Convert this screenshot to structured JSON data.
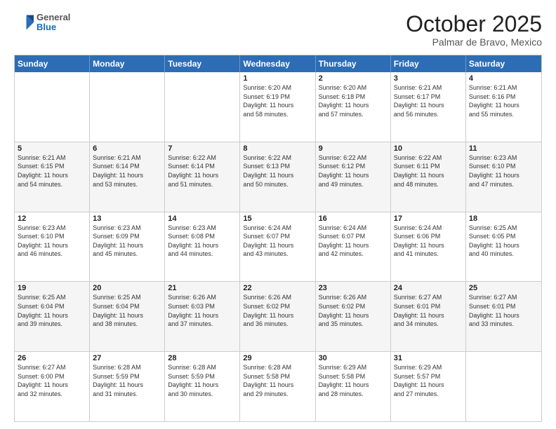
{
  "header": {
    "logo": {
      "general": "General",
      "blue": "Blue"
    },
    "title": "October 2025",
    "location": "Palmar de Bravo, Mexico"
  },
  "calendar": {
    "days": [
      "Sunday",
      "Monday",
      "Tuesday",
      "Wednesday",
      "Thursday",
      "Friday",
      "Saturday"
    ],
    "rows": [
      [
        {
          "day": "",
          "info": ""
        },
        {
          "day": "",
          "info": ""
        },
        {
          "day": "",
          "info": ""
        },
        {
          "day": "1",
          "info": "Sunrise: 6:20 AM\nSunset: 6:19 PM\nDaylight: 11 hours\nand 58 minutes."
        },
        {
          "day": "2",
          "info": "Sunrise: 6:20 AM\nSunset: 6:18 PM\nDaylight: 11 hours\nand 57 minutes."
        },
        {
          "day": "3",
          "info": "Sunrise: 6:21 AM\nSunset: 6:17 PM\nDaylight: 11 hours\nand 56 minutes."
        },
        {
          "day": "4",
          "info": "Sunrise: 6:21 AM\nSunset: 6:16 PM\nDaylight: 11 hours\nand 55 minutes."
        }
      ],
      [
        {
          "day": "5",
          "info": "Sunrise: 6:21 AM\nSunset: 6:15 PM\nDaylight: 11 hours\nand 54 minutes."
        },
        {
          "day": "6",
          "info": "Sunrise: 6:21 AM\nSunset: 6:14 PM\nDaylight: 11 hours\nand 53 minutes."
        },
        {
          "day": "7",
          "info": "Sunrise: 6:22 AM\nSunset: 6:14 PM\nDaylight: 11 hours\nand 51 minutes."
        },
        {
          "day": "8",
          "info": "Sunrise: 6:22 AM\nSunset: 6:13 PM\nDaylight: 11 hours\nand 50 minutes."
        },
        {
          "day": "9",
          "info": "Sunrise: 6:22 AM\nSunset: 6:12 PM\nDaylight: 11 hours\nand 49 minutes."
        },
        {
          "day": "10",
          "info": "Sunrise: 6:22 AM\nSunset: 6:11 PM\nDaylight: 11 hours\nand 48 minutes."
        },
        {
          "day": "11",
          "info": "Sunrise: 6:23 AM\nSunset: 6:10 PM\nDaylight: 11 hours\nand 47 minutes."
        }
      ],
      [
        {
          "day": "12",
          "info": "Sunrise: 6:23 AM\nSunset: 6:10 PM\nDaylight: 11 hours\nand 46 minutes."
        },
        {
          "day": "13",
          "info": "Sunrise: 6:23 AM\nSunset: 6:09 PM\nDaylight: 11 hours\nand 45 minutes."
        },
        {
          "day": "14",
          "info": "Sunrise: 6:23 AM\nSunset: 6:08 PM\nDaylight: 11 hours\nand 44 minutes."
        },
        {
          "day": "15",
          "info": "Sunrise: 6:24 AM\nSunset: 6:07 PM\nDaylight: 11 hours\nand 43 minutes."
        },
        {
          "day": "16",
          "info": "Sunrise: 6:24 AM\nSunset: 6:07 PM\nDaylight: 11 hours\nand 42 minutes."
        },
        {
          "day": "17",
          "info": "Sunrise: 6:24 AM\nSunset: 6:06 PM\nDaylight: 11 hours\nand 41 minutes."
        },
        {
          "day": "18",
          "info": "Sunrise: 6:25 AM\nSunset: 6:05 PM\nDaylight: 11 hours\nand 40 minutes."
        }
      ],
      [
        {
          "day": "19",
          "info": "Sunrise: 6:25 AM\nSunset: 6:04 PM\nDaylight: 11 hours\nand 39 minutes."
        },
        {
          "day": "20",
          "info": "Sunrise: 6:25 AM\nSunset: 6:04 PM\nDaylight: 11 hours\nand 38 minutes."
        },
        {
          "day": "21",
          "info": "Sunrise: 6:26 AM\nSunset: 6:03 PM\nDaylight: 11 hours\nand 37 minutes."
        },
        {
          "day": "22",
          "info": "Sunrise: 6:26 AM\nSunset: 6:02 PM\nDaylight: 11 hours\nand 36 minutes."
        },
        {
          "day": "23",
          "info": "Sunrise: 6:26 AM\nSunset: 6:02 PM\nDaylight: 11 hours\nand 35 minutes."
        },
        {
          "day": "24",
          "info": "Sunrise: 6:27 AM\nSunset: 6:01 PM\nDaylight: 11 hours\nand 34 minutes."
        },
        {
          "day": "25",
          "info": "Sunrise: 6:27 AM\nSunset: 6:01 PM\nDaylight: 11 hours\nand 33 minutes."
        }
      ],
      [
        {
          "day": "26",
          "info": "Sunrise: 6:27 AM\nSunset: 6:00 PM\nDaylight: 11 hours\nand 32 minutes."
        },
        {
          "day": "27",
          "info": "Sunrise: 6:28 AM\nSunset: 5:59 PM\nDaylight: 11 hours\nand 31 minutes."
        },
        {
          "day": "28",
          "info": "Sunrise: 6:28 AM\nSunset: 5:59 PM\nDaylight: 11 hours\nand 30 minutes."
        },
        {
          "day": "29",
          "info": "Sunrise: 6:28 AM\nSunset: 5:58 PM\nDaylight: 11 hours\nand 29 minutes."
        },
        {
          "day": "30",
          "info": "Sunrise: 6:29 AM\nSunset: 5:58 PM\nDaylight: 11 hours\nand 28 minutes."
        },
        {
          "day": "31",
          "info": "Sunrise: 6:29 AM\nSunset: 5:57 PM\nDaylight: 11 hours\nand 27 minutes."
        },
        {
          "day": "",
          "info": ""
        }
      ]
    ]
  }
}
